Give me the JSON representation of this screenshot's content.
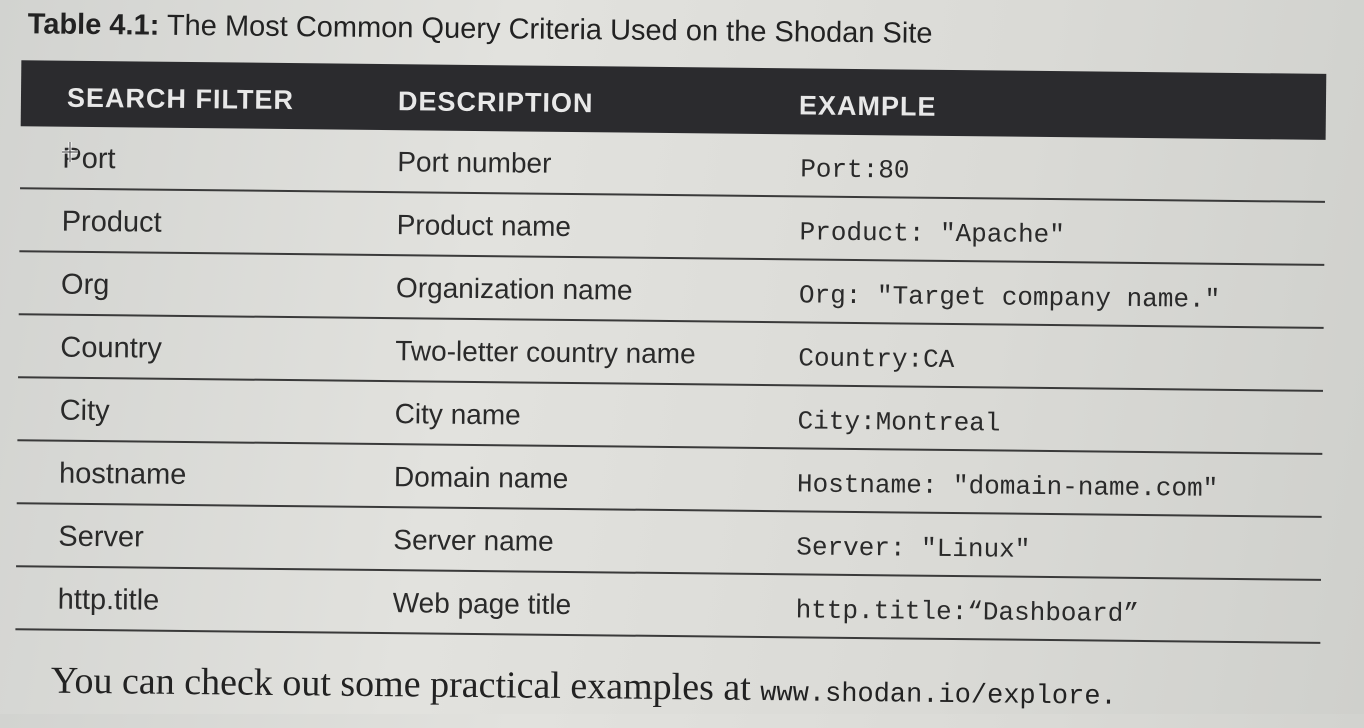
{
  "caption": {
    "label": "Table 4.1:",
    "title": "The Most Common Query Criteria Used on the Shodan Site"
  },
  "table": {
    "headers": [
      "SEARCH FILTER",
      "DESCRIPTION",
      "EXAMPLE"
    ],
    "rows": [
      [
        "Port",
        "Port number",
        "Port:80"
      ],
      [
        "Product",
        "Product name",
        "Product: \"Apache\""
      ],
      [
        "Org",
        "Organization name",
        "Org: \"Target company name.\""
      ],
      [
        "Country",
        "Two-letter country name",
        "Country:CA"
      ],
      [
        "City",
        "City name",
        "City:Montreal"
      ],
      [
        "hostname",
        "Domain name",
        "Hostname: \"domain-name.com\""
      ],
      [
        "Server",
        "Server name",
        "Server: \"Linux\""
      ],
      [
        "http.title",
        "Web page title",
        "http.title:“Dashboard”"
      ]
    ]
  },
  "footer": {
    "text": "You can check out some practical examples at ",
    "link": "www.shodan.io/explore."
  }
}
